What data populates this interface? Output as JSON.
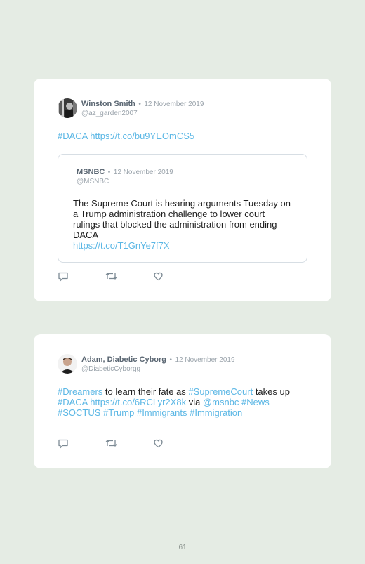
{
  "tweets": [
    {
      "author_name": "Winston Smith",
      "separator": "•",
      "date": "12 November 2019",
      "handle": "@az_garden2007",
      "text_parts": [
        {
          "text": "#DACA",
          "link": true
        },
        {
          "text": " ",
          "link": false
        },
        {
          "text": "https://t.co/bu9YEOmCS5",
          "link": true
        }
      ],
      "quote": {
        "author_name": "MSNBC",
        "separator": "•",
        "date": "12 November 2019",
        "handle": "@MSNBC",
        "text": "The Supreme Court is hearing arguments Tuesday on a Trump administration challenge to lower court rulings that blocked the administration from ending DACA",
        "link": "https://t.co/T1GnYe7f7X"
      }
    },
    {
      "author_name": "Adam, Diabetic Cyborg",
      "separator": "•",
      "date": "12 November 2019",
      "handle": "@DiabeticCyborgg",
      "text_parts": [
        {
          "text": "#Dreamers",
          "link": true
        },
        {
          "text": " to learn their fate as ",
          "link": false
        },
        {
          "text": "#SupremeCourt",
          "link": true
        },
        {
          "text": " takes up ",
          "link": false
        },
        {
          "text": "#DACA",
          "link": true
        },
        {
          "text": " ",
          "link": false
        },
        {
          "text": "https://t.co/6RCLyr2X8k",
          "link": true
        },
        {
          "text": " via ",
          "link": false
        },
        {
          "text": "@msnbc",
          "link": true
        },
        {
          "text": " ",
          "link": false
        },
        {
          "text": "#News",
          "link": true
        },
        {
          "text": " ",
          "link": false
        },
        {
          "text": "#SOCTUS",
          "link": true
        },
        {
          "text": " ",
          "link": false
        },
        {
          "text": "#Trump",
          "link": true
        },
        {
          "text": " ",
          "link": false
        },
        {
          "text": "#Immigrants",
          "link": true
        },
        {
          "text": " ",
          "link": false
        },
        {
          "text": "#Immigration",
          "link": true
        }
      ]
    }
  ],
  "icons": [
    "reply-icon",
    "retweet-icon",
    "like-icon"
  ],
  "colors": {
    "link": "#5bb7e5",
    "background": "#e5ece4",
    "card": "#ffffff"
  },
  "page_number": "61"
}
